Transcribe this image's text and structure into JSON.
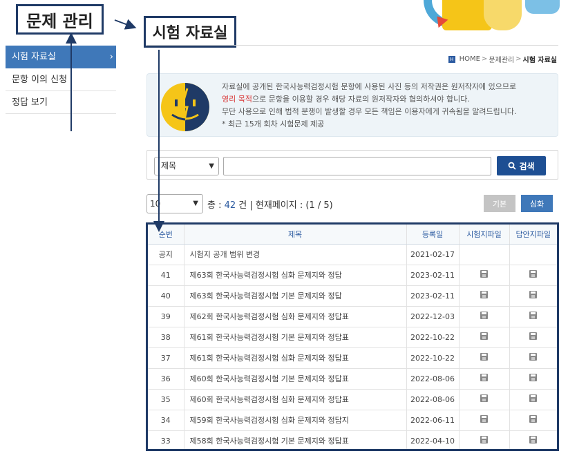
{
  "annotations": {
    "left_box": "문제 관리",
    "right_box": "시험 자료실"
  },
  "sidebar": {
    "items": [
      {
        "label": "시험 자료실",
        "active": true
      },
      {
        "label": "문항 이의 신청",
        "active": false
      },
      {
        "label": "정답 보기",
        "active": false
      }
    ],
    "chevron": "›"
  },
  "breadcrumb": {
    "home": "HOME",
    "separator": ">",
    "level1": "문제관리",
    "current": "시험 자료실"
  },
  "notice": {
    "line1": "자료실에 공개된 한국사능력검정시험 문항에 사용된 사진 등의 저작권은 원저작자에 있으므로",
    "line2_red": "영리 목적",
    "line2_rest": "으로 문항을 이용할 경우 해당 자료의 원저작자와 협의하셔야 합니다.",
    "line3": "무단 사용으로 인해 법적 분쟁이 발생할 경우 모든 책임은 이용자에게 귀속됨을 알려드립니다.",
    "line4": "* 최근 15개 회차 시험문제 제공"
  },
  "search": {
    "select_value": "제목",
    "input_value": "",
    "button_label": "검색"
  },
  "list": {
    "page_size": "10",
    "total_label": "총 : ",
    "total_count": "42",
    "total_unit": " 건 | 현재페이지 : (1 / 5)",
    "btn_basic": "기본",
    "btn_advanced": "심화"
  },
  "table": {
    "headers": [
      "순번",
      "제목",
      "등록일",
      "시험지파일",
      "답안지파일"
    ],
    "rows": [
      {
        "no": "공지",
        "title": "시험지 공개 범위 변경",
        "date": "2021-02-17",
        "exam_file": false,
        "answer_file": false
      },
      {
        "no": "41",
        "title": "제63회 한국사능력검정시험 심화 문제지와 정답",
        "date": "2023-02-11",
        "exam_file": true,
        "answer_file": true
      },
      {
        "no": "40",
        "title": "제63회 한국사능력검정시험 기본 문제지와 정답",
        "date": "2023-02-11",
        "exam_file": true,
        "answer_file": true
      },
      {
        "no": "39",
        "title": "제62회 한국사능력검정시험 심화 문제지와 정답표",
        "date": "2022-12-03",
        "exam_file": true,
        "answer_file": true
      },
      {
        "no": "38",
        "title": "제61회 한국사능력검정시험 기본 문제지와 정답표",
        "date": "2022-10-22",
        "exam_file": true,
        "answer_file": true
      },
      {
        "no": "37",
        "title": "제61회 한국사능력검정시험 심화 문제지와 정답표",
        "date": "2022-10-22",
        "exam_file": true,
        "answer_file": true
      },
      {
        "no": "36",
        "title": "제60회 한국사능력검정시험 기본 문제지와 정답표",
        "date": "2022-08-06",
        "exam_file": true,
        "answer_file": true
      },
      {
        "no": "35",
        "title": "제60회 한국사능력검정시험 심화 문제지와 정답표",
        "date": "2022-08-06",
        "exam_file": true,
        "answer_file": true
      },
      {
        "no": "34",
        "title": "제59회 한국사능력검정시험 심화 문제지와 정답지",
        "date": "2022-06-11",
        "exam_file": true,
        "answer_file": true
      },
      {
        "no": "33",
        "title": "제58회 한국사능력검정시험 기본 문제지와 정답표",
        "date": "2022-04-10",
        "exam_file": true,
        "answer_file": true
      }
    ]
  },
  "colors": {
    "primary_blue": "#3f78b9",
    "dark_blue": "#1e4f93",
    "annotation_border": "#1f3a66",
    "accent_red": "#d93b3b"
  },
  "icons": {
    "file": "floppy-disk-icon",
    "search": "search-icon",
    "home": "home-icon"
  }
}
